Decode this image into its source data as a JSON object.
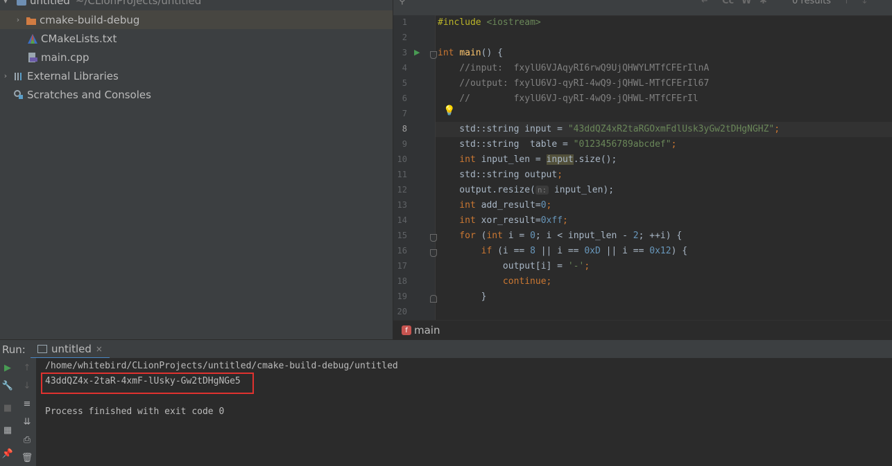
{
  "project": {
    "root_name": "untitled",
    "root_path": "~/CLionProjects/untitled",
    "items": [
      {
        "label": "cmake-build-debug",
        "icon": "folder-icon"
      },
      {
        "label": "CMakeLists.txt",
        "icon": "cmake-icon"
      },
      {
        "label": "main.cpp",
        "icon": "cpp-file-icon"
      },
      {
        "label": "External Libraries",
        "icon": "libraries-icon"
      },
      {
        "label": "Scratches and Consoles",
        "icon": "scratches-icon"
      }
    ]
  },
  "findbar": {
    "results": "0 results",
    "case_label": "Cc",
    "word_label": "W"
  },
  "editor": {
    "line_numbers": [
      "1",
      "2",
      "3",
      "4",
      "5",
      "6",
      "7",
      "8",
      "9",
      "10",
      "11",
      "12",
      "13",
      "14",
      "15",
      "16",
      "17",
      "18",
      "19",
      "20"
    ],
    "current_line": "8",
    "lines": {
      "l1_pre": "#include ",
      "l1_inc": "<iostream>",
      "l3_kw": "int ",
      "l3_fn": "main",
      "l3_rest": "() {",
      "l4": "    //input:  fxylU6VJAqyRI6rwQ9UjQHWYLMTfCFErIlnA",
      "l5": "    //output: fxylU6VJ-qyRI-4wQ9-jQHWL-MTfCFErIl67",
      "l6": "    //        fxylU6VJ-qyRI-4wQ9-jQHWL-MTfCFErIl",
      "l8_a": "    std::string input = ",
      "l8_str": "\"43ddQZ4xR2taRGOxmFdlUsk3yGw2tDHgNGHZ\"",
      "l8_end": ";",
      "l9_a": "    std::string  table = ",
      "l9_str": "\"0123456789abcdef\"",
      "l9_end": ";",
      "l10_kw": "    int ",
      "l10_a": "input_len = ",
      "l10_hl": "input",
      "l10_b": ".size();",
      "l11_a": "    std::string output",
      "l11_end": ";",
      "l12_a": "    output.resize(",
      "l12_hint": "n:",
      "l12_b": " input_len);",
      "l13_kw": "    int ",
      "l13_a": "add_result=",
      "l13_num": "0",
      "l13_end": ";",
      "l14_kw": "    int ",
      "l14_a": "xor_result=",
      "l14_num": "0xff",
      "l14_end": ";",
      "l15_kw": "    for ",
      "l15_a": "(",
      "l15_kw2": "int ",
      "l15_b": "i = ",
      "l15_n0": "0",
      "l15_c": "; i < input_len - ",
      "l15_n2": "2",
      "l15_d": "; ++i) {",
      "l16_kw": "        if ",
      "l16_a": "(i == ",
      "l16_n1": "8",
      "l16_b": " || i == ",
      "l16_n2": "0xD",
      "l16_c": " || i == ",
      "l16_n3": "0x12",
      "l16_d": ") {",
      "l17_a": "            output[i] = ",
      "l17_str": "'-'",
      "l17_end": ";",
      "l18_kw": "            continue",
      "l18_end": ";",
      "l19": "        }"
    }
  },
  "breadcrumb": {
    "badge": "f",
    "label": "main"
  },
  "run": {
    "title": "Run:",
    "tab_label": "untitled",
    "console": {
      "path": "/home/whitebird/CLionProjects/untitled/cmake-build-debug/untitled",
      "output": "43ddQZ4x-2taR-4xmF-lUsky-Gw2tDHgNGe5",
      "finished": "Process finished with exit code 0"
    }
  },
  "colors": {
    "highlight_box": "#e0322f",
    "tab_underline": "#4a88c7",
    "run_green": "#499c54"
  }
}
